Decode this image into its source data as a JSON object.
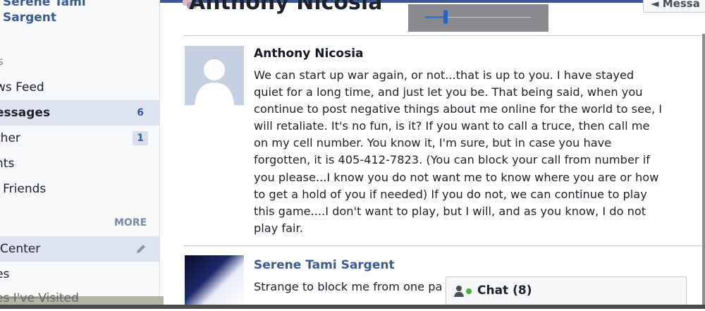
{
  "sidebar": {
    "profile_name": "Serene Tami\nSargent",
    "section_header": "s",
    "items": [
      {
        "label": "ws Feed",
        "count": ""
      },
      {
        "label": "essages",
        "count": "6"
      },
      {
        "label": "ther",
        "count": "1"
      },
      {
        "label": "nts",
        "count": ""
      },
      {
        "label": "l Friends",
        "count": ""
      }
    ],
    "more_label": "MORE",
    "items2": [
      {
        "label": "Center"
      },
      {
        "label": "es"
      },
      {
        "label": "es I've Visited"
      }
    ]
  },
  "conversation": {
    "title": "Anthony Nicosia",
    "message_button_label": "◄ Messa"
  },
  "messages": [
    {
      "author": "Anthony Nicosia",
      "lines": [
        "We can start up war again, or not...that is up to you. I have stayed",
        "quiet for a long time, and just let you be. That being said, when you",
        "continue to post negative things about me online for the world to see, I",
        "will retaliate. It's no fun, is it? If you want to call a truce, then call me",
        "on my cell number. You know it, I'm sure, but in case you have",
        "forgotten, it is 405-412-7823. (You can block your call from number if",
        "you please...I know you do not want me to know where you are or how",
        "to get a hold of you if needed) If you do not, we can continue to play",
        "this game....I don't want to play, but I will, and as you know, I do not",
        "play fair."
      ]
    },
    {
      "author": "Serene Tami Sargent",
      "lines": [
        "Strange to block me from one pa"
      ]
    }
  ],
  "chat": {
    "label": "Chat (8)"
  },
  "overlay": {
    "slider_value_fraction": 0.18
  },
  "colors": {
    "brand": "#3b5998",
    "active_bg": "#dde3ef",
    "chat_online": "#42b72a"
  }
}
